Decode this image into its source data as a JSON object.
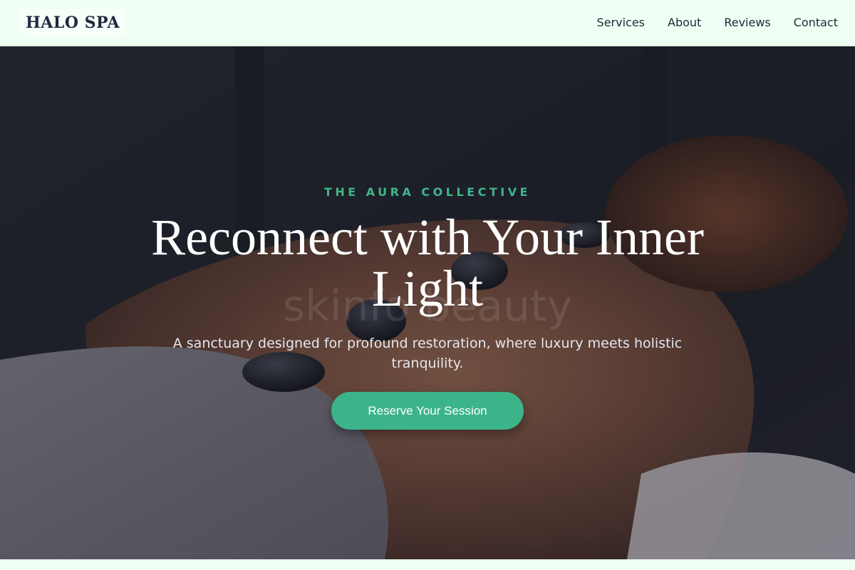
{
  "nav": {
    "logo": "HALO SPA",
    "links": [
      "Services",
      "About",
      "Reviews",
      "Contact"
    ]
  },
  "hero": {
    "eyebrow": "THE AURA COLLECTIVE",
    "headline": "Reconnect with Your Inner Light",
    "watermark": "skinfo   beauty",
    "subhead": "A sanctuary designed for profound restoration, where luxury meets holistic tranquility.",
    "cta_label": "Reserve Your Session"
  },
  "colors": {
    "accent": "#3cb489",
    "eyebrow": "#3fb68a",
    "nav_background": "#f0fff4",
    "logo_text": "#1e2a3e"
  },
  "icons": {
    "hero_image": "hot-stone-massage-photo"
  }
}
